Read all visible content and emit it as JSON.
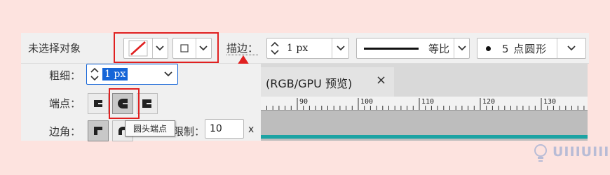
{
  "control_bar": {
    "selection_label": "未选择对象",
    "stroke_label": "描边：",
    "stroke_weight_value": "1 px",
    "profile_label": "等比",
    "brush_label": "5 点圆形"
  },
  "stroke_panel": {
    "weight_label": "粗细：",
    "weight_value": "1 px",
    "cap_label": "端点：",
    "corner_label": "边角：",
    "limit_label": "限制：",
    "limit_value": "10",
    "limit_unit": "x"
  },
  "tooltip": {
    "text": "圆头端点"
  },
  "document_tab": {
    "title": "(RGB/GPU 预览)",
    "close_label": "×"
  },
  "ruler": {
    "labels": [
      "90",
      "100",
      "110",
      "120",
      "130"
    ]
  },
  "watermark": {
    "text": "UIIIUIII"
  },
  "colors": {
    "highlight_red": "#e02020",
    "selection_blue": "#1565d8",
    "canvas_accent": "#1ba3a3"
  },
  "icons": [
    "no-fill-swatch-icon",
    "stroke-swatch-icon",
    "chevron-down-icon",
    "spinner-arrows-icon",
    "butt-cap-icon",
    "round-cap-icon",
    "projecting-cap-icon",
    "miter-join-icon",
    "round-join-icon",
    "close-icon",
    "red-arrow-annotation",
    "lightbulb-logo-icon"
  ]
}
